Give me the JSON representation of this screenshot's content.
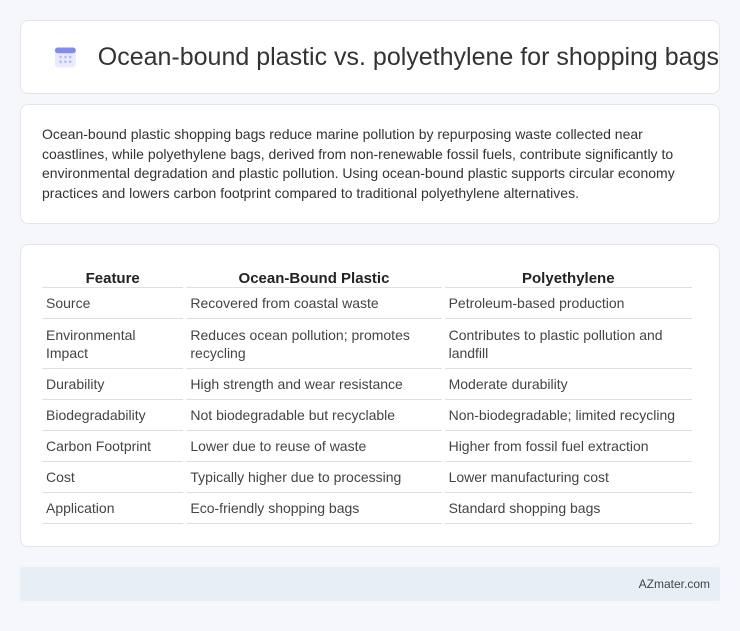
{
  "header": {
    "icon": "calendar-icon",
    "title": "Ocean-bound plastic vs. polyethylene for shopping bags"
  },
  "intro": {
    "text": "Ocean-bound plastic shopping bags reduce marine pollution by repurposing waste collected near coastlines, while polyethylene bags, derived from non-renewable fossil fuels, contribute significantly to environmental degradation and plastic pollution. Using ocean-bound plastic supports circular economy practices and lowers carbon footprint compared to traditional polyethylene alternatives."
  },
  "table": {
    "headers": [
      "Feature",
      "Ocean-Bound Plastic",
      "Polyethylene"
    ],
    "rows": [
      [
        "Source",
        "Recovered from coastal waste",
        "Petroleum-based production"
      ],
      [
        "Environmental Impact",
        "Reduces ocean pollution; promotes recycling",
        "Contributes to plastic pollution and landfill"
      ],
      [
        "Durability",
        "High strength and wear resistance",
        "Moderate durability"
      ],
      [
        "Biodegradability",
        "Not biodegradable but recyclable",
        "Non-biodegradable; limited recycling"
      ],
      [
        "Carbon Footprint",
        "Lower due to reuse of waste",
        "Higher from fossil fuel extraction"
      ],
      [
        "Cost",
        "Typically higher due to processing",
        "Lower manufacturing cost"
      ],
      [
        "Application",
        "Eco-friendly shopping bags",
        "Standard shopping bags"
      ]
    ]
  },
  "footer": {
    "brand": "AZmater.com"
  },
  "colors": {
    "accent": "#6f7df0",
    "background": "#f5f7fa",
    "footer_bg": "#e8eef6"
  }
}
